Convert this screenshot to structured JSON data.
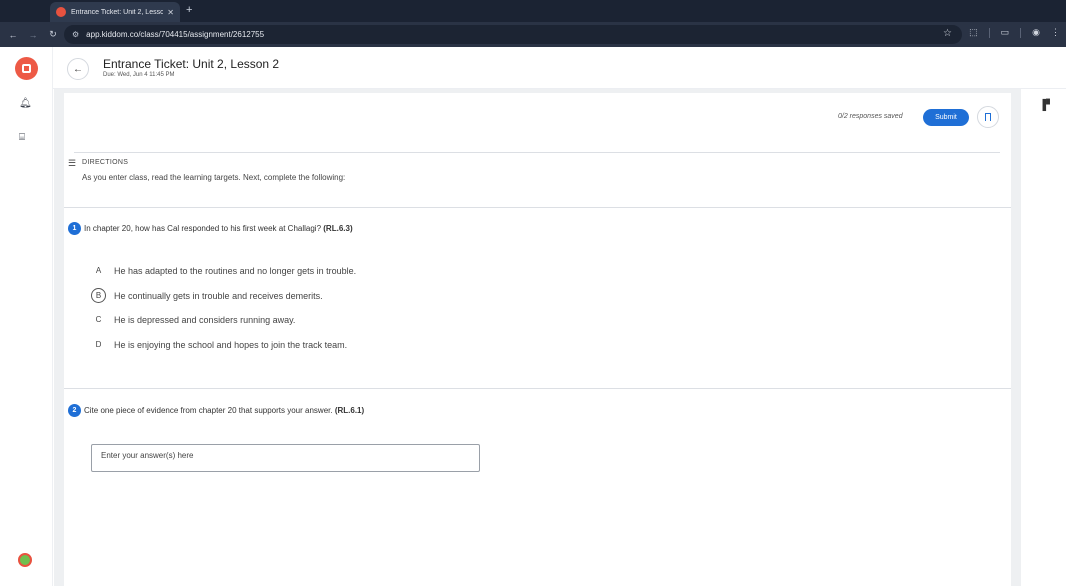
{
  "browser": {
    "tab_title": "Entrance Ticket: Unit 2, Lesso",
    "url": "app.kiddom.co/class/704415/assignment/2612755"
  },
  "header": {
    "title": "Entrance Ticket: Unit 2, Lesson 2",
    "due": "Due: Wed, Jun 4 11:45 PM"
  },
  "toolbar": {
    "responses_saved": "0/2 responses saved",
    "submit_label": "Submit"
  },
  "directions": {
    "label": "DIRECTIONS",
    "text": "As you enter class, read the learning targets. Next, complete the following:"
  },
  "questions": [
    {
      "number": "1",
      "text": "In chapter 20, how has Cal responded to his first week at Challagi?",
      "standard": "(RL.6.3)",
      "choices": [
        {
          "letter": "A",
          "text": "He has adapted to the routines and no longer gets in trouble.",
          "selected": false
        },
        {
          "letter": "B",
          "text": "He continually gets in trouble and receives demerits.",
          "selected": true
        },
        {
          "letter": "C",
          "text": "He is depressed and considers running away.",
          "selected": false
        },
        {
          "letter": "D",
          "text": "He is enjoying the school and hopes to join the track team.",
          "selected": false
        }
      ]
    },
    {
      "number": "2",
      "text": "Cite one piece of evidence from chapter 20 that supports your answer.",
      "standard": "(RL.6.1)",
      "answer_placeholder": "Enter your answer(s) here"
    }
  ],
  "colors": {
    "accent": "#1f6fd6",
    "brand": "#ed5a46"
  }
}
